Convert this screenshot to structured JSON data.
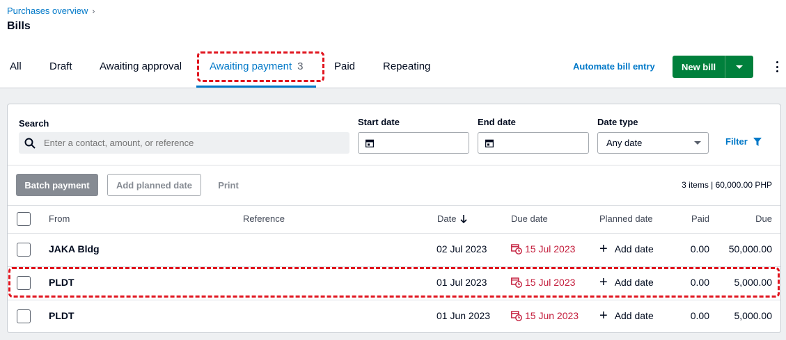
{
  "breadcrumb": {
    "label": "Purchases overview",
    "separator": "›"
  },
  "page": {
    "title": "Bills"
  },
  "tabs": [
    {
      "label": "All"
    },
    {
      "label": "Draft"
    },
    {
      "label": "Awaiting approval"
    },
    {
      "label": "Awaiting payment",
      "count": "3",
      "active": true
    },
    {
      "label": "Paid"
    },
    {
      "label": "Repeating"
    }
  ],
  "actions": {
    "automate": "Automate bill entry",
    "new_bill": "New bill"
  },
  "filters": {
    "search_label": "Search",
    "search_placeholder": "Enter a contact, amount, or reference",
    "start_date_label": "Start date",
    "end_date_label": "End date",
    "date_type_label": "Date type",
    "date_type_value": "Any date",
    "filter_label": "Filter"
  },
  "toolbar": {
    "batch_payment": "Batch payment",
    "add_planned_date": "Add planned date",
    "print": "Print",
    "summary": "3 items | 60,000.00 PHP"
  },
  "table": {
    "columns": {
      "from": "From",
      "reference": "Reference",
      "date": "Date",
      "due_date": "Due date",
      "planned_date": "Planned date",
      "paid": "Paid",
      "due": "Due"
    },
    "rows": [
      {
        "from": "JAKA Bldg",
        "reference": "",
        "date": "02 Jul 2023",
        "due_date": "15 Jul 2023",
        "planned_date": "Add date",
        "paid": "0.00",
        "due": "50,000.00"
      },
      {
        "from": "PLDT",
        "reference": "",
        "date": "01 Jul 2023",
        "due_date": "15 Jul 2023",
        "planned_date": "Add date",
        "paid": "0.00",
        "due": "5,000.00"
      },
      {
        "from": "PLDT",
        "reference": "",
        "date": "01 Jun 2023",
        "due_date": "15 Jun 2023",
        "planned_date": "Add date",
        "paid": "0.00",
        "due": "5,000.00"
      }
    ]
  },
  "colors": {
    "accent": "#0078c8",
    "primary_button": "#00803c",
    "overdue": "#c31b3a",
    "highlight": "#e0141e"
  },
  "icons": [
    "chevron-right-icon",
    "search-icon",
    "calendar-icon",
    "filter-icon",
    "sort-down-icon",
    "overdue-clock-icon",
    "plus-icon",
    "more-vertical-icon"
  ]
}
